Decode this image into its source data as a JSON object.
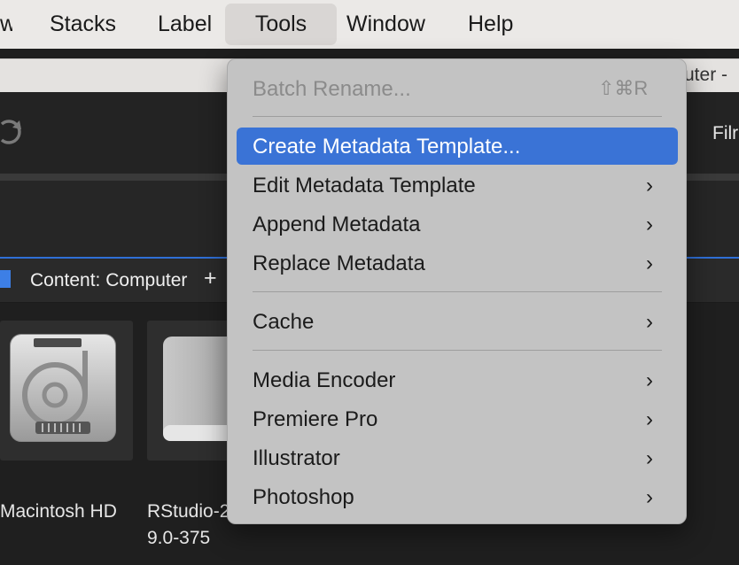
{
  "menubar": {
    "items": [
      {
        "label": "w"
      },
      {
        "label": "Stacks"
      },
      {
        "label": "Label"
      },
      {
        "label": "Tools"
      },
      {
        "label": "Window"
      },
      {
        "label": "Help"
      }
    ]
  },
  "window": {
    "title_fragment": "uter -"
  },
  "toolbar": {
    "filter_label_fragment": "Filr",
    "refresh_icon": "refresh-icon"
  },
  "content_panel": {
    "title": "Content: Computer",
    "add_label": "+",
    "items": [
      {
        "label_line1": "Macintosh HD",
        "label_line2": "",
        "icon": "hard-disk-icon"
      },
      {
        "label_line1": "RStudio-2",
        "label_line2": "9.0-375",
        "icon": "disk-image-icon"
      }
    ]
  },
  "tools_menu": {
    "items": [
      {
        "label": "Batch Rename...",
        "shortcut": "⇧⌘R",
        "disabled": true
      },
      {
        "label": "Create Metadata Template...",
        "highlighted": true
      },
      {
        "label": "Edit Metadata Template",
        "submenu": "›"
      },
      {
        "label": "Append Metadata",
        "submenu": "›"
      },
      {
        "label": "Replace Metadata",
        "submenu": "›"
      },
      {
        "label": "Cache",
        "submenu": "›"
      },
      {
        "label": "Media Encoder",
        "submenu": "›"
      },
      {
        "label": "Premiere Pro",
        "submenu": "›"
      },
      {
        "label": "Illustrator",
        "submenu": "›"
      },
      {
        "label": "Photoshop",
        "submenu": "›"
      }
    ]
  },
  "colors": {
    "highlight": "#3a73d6",
    "accent": "#3d7fe6"
  }
}
